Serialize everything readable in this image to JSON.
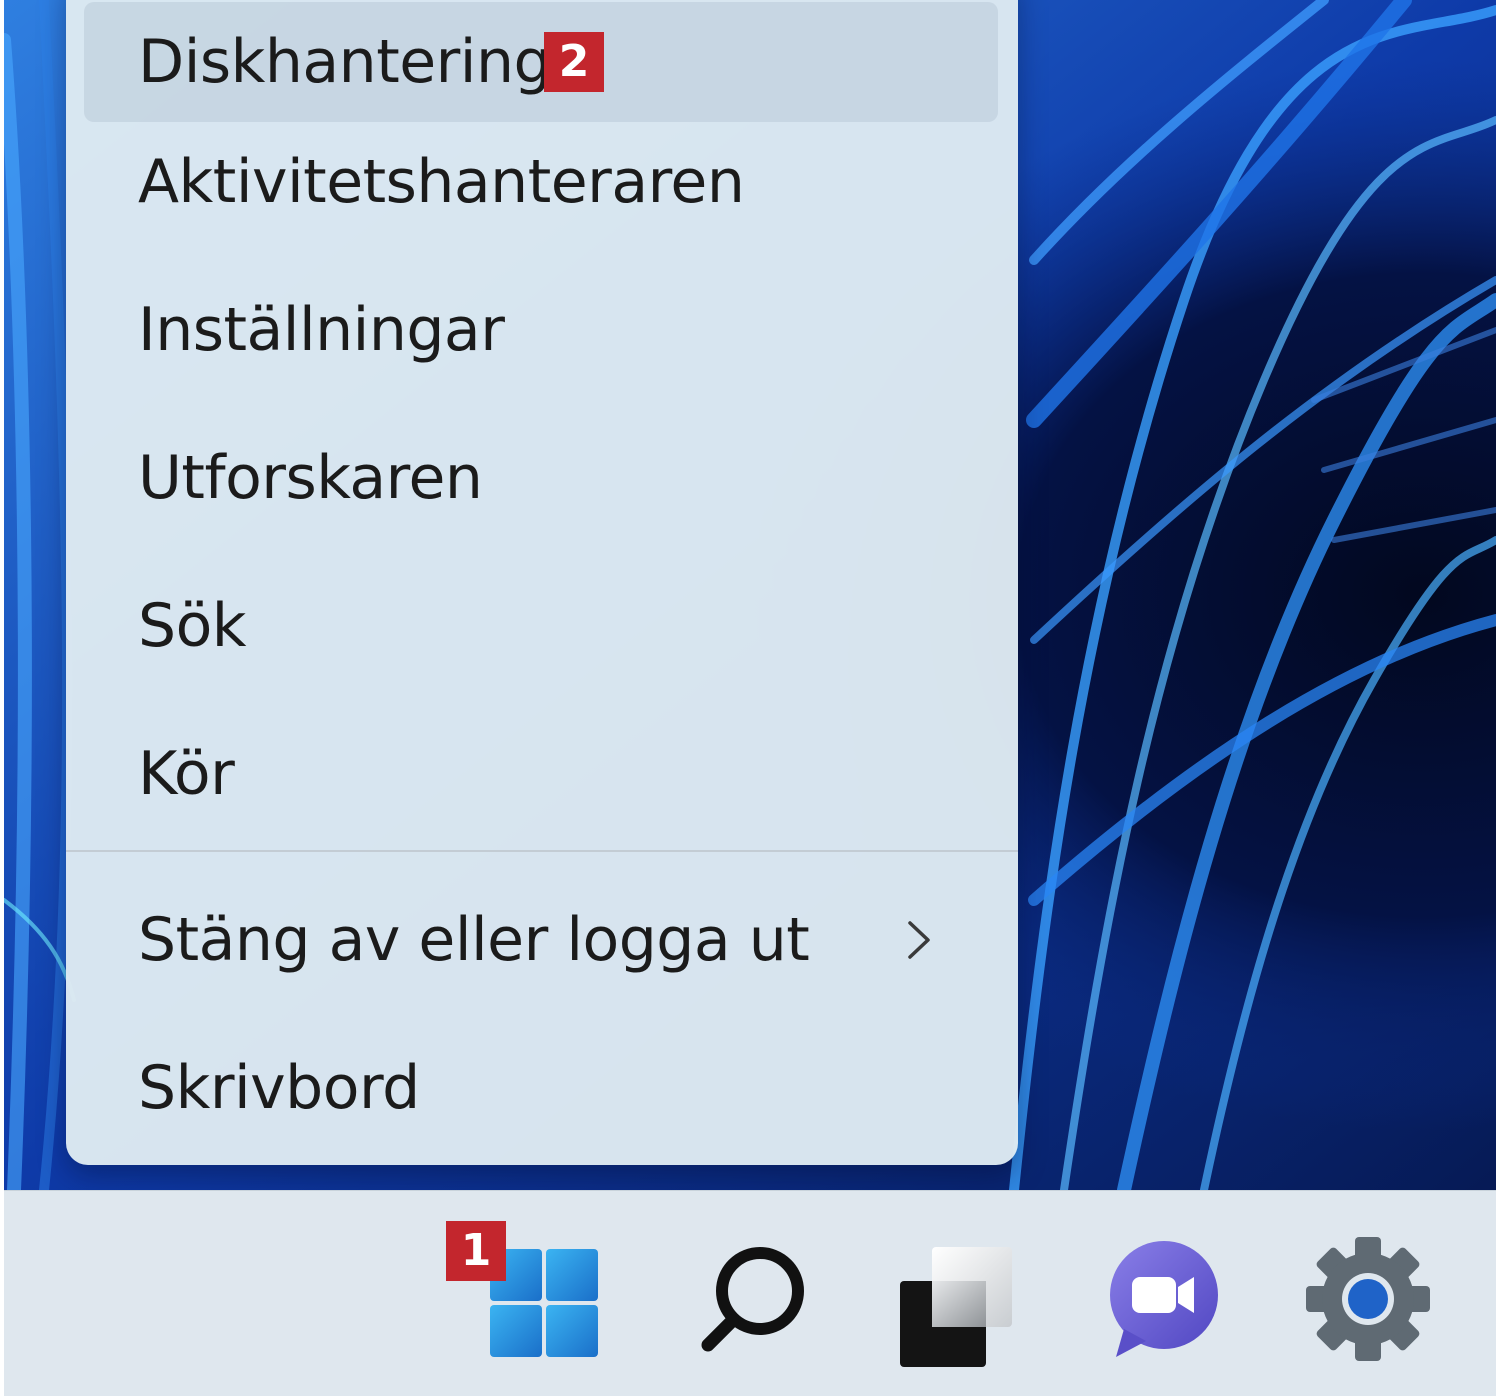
{
  "context_menu": {
    "items": [
      {
        "label": "Diskhantering",
        "badge": "2"
      },
      {
        "label": "Aktivitetshanteraren"
      },
      {
        "label": "Inställningar"
      },
      {
        "label": "Utforskaren"
      },
      {
        "label": "Sök"
      },
      {
        "label": "Kör"
      },
      {
        "label": "Stäng av eller logga ut"
      },
      {
        "label": "Skrivbord"
      }
    ],
    "hover_color": "#bfcedc",
    "background_color": "#deeaf2"
  },
  "taskbar": {
    "start_button": {
      "badge": "1",
      "icon": "windows-logo-icon"
    },
    "buttons": [
      {
        "icon": "search-icon"
      },
      {
        "icon": "task-view-icon"
      },
      {
        "icon": "chat-icon"
      },
      {
        "icon": "settings-gear-icon"
      }
    ]
  },
  "colors": {
    "badge_red": "#c3262d",
    "wallpaper_blue": "#1b5fd6",
    "chat_purple": "#6b5bd0",
    "windows_blue": "#2a8fd8"
  }
}
